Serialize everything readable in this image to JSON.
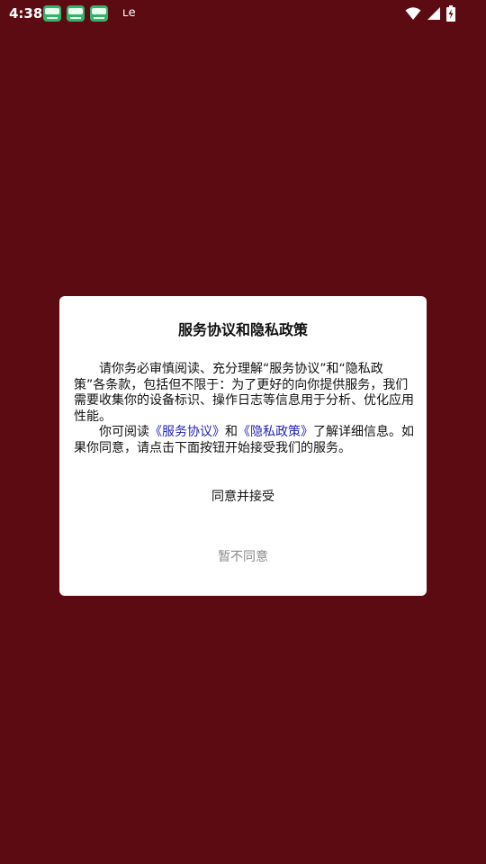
{
  "status_bar": {
    "time": "4:38",
    "misc_symbol": "ʟe",
    "notification_icons": [
      "app-notification-icon",
      "app-notification-icon",
      "app-notification-icon"
    ],
    "system_icons": [
      "wifi-icon",
      "signal-icon",
      "battery-charging-icon"
    ]
  },
  "colors": {
    "background": "#5c0b12",
    "dialog": "#ffffff",
    "link": "#2323b8",
    "secondary_text": "#8a8a8a"
  },
  "dialog": {
    "title": "服务协议和隐私政策",
    "paragraph1": "请你务必审慎阅读、充分理解“服务协议”和“隐私政策”各条款，包括但不限于：为了更好的向你提供服务，我们需要收集你的设备标识、操作日志等信息用于分析、优化应用性能。",
    "paragraph2_prefix": "你可阅读",
    "service_link": "《服务协议》",
    "conjunction": "和",
    "privacy_link": "《隐私政策》",
    "paragraph2_suffix": "了解详细信息。如果你同意，请点击下面按钮开始接受我们的服务。",
    "agree_label": "同意并接受",
    "decline_label": "暂不同意"
  }
}
